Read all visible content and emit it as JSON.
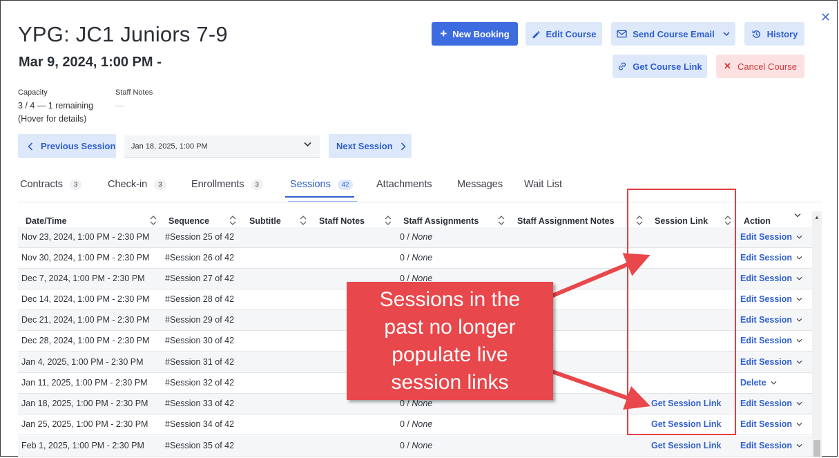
{
  "header": {
    "title": "YPG: JC1 Juniors 7-9",
    "subtitle": "Mar 9, 2024, 1:00 PM -"
  },
  "toolbar": {
    "new_booking": "New Booking",
    "edit_course": "Edit Course",
    "send_course_email": "Send Course Email",
    "history": "History",
    "get_course_link": "Get Course Link",
    "cancel_course": "Cancel Course"
  },
  "meta": {
    "capacity_label": "Capacity",
    "capacity_value": "3 / 4 — 1 remaining",
    "capacity_hint": "(Hover for details)",
    "staff_notes_label": "Staff Notes",
    "staff_notes_value": "—"
  },
  "session_nav": {
    "previous": "Previous Session",
    "selected": "Jan 18, 2025, 1:00 PM",
    "next": "Next Session"
  },
  "tabs": [
    {
      "label": "Contracts",
      "badge": "3"
    },
    {
      "label": "Check-in",
      "badge": "3"
    },
    {
      "label": "Enrollments",
      "badge": "3"
    },
    {
      "label": "Sessions",
      "badge": "42"
    },
    {
      "label": "Attachments",
      "badge": ""
    },
    {
      "label": "Messages",
      "badge": ""
    },
    {
      "label": "Wait List",
      "badge": ""
    }
  ],
  "table": {
    "columns": [
      "Date/Time",
      "Sequence",
      "Subtitle",
      "Staff Notes",
      "Staff Assignments",
      "Staff Assignment Notes",
      "Session Link",
      "Action"
    ],
    "rows": [
      {
        "date": "Nov 23, 2024, 1:00 PM - 2:30 PM",
        "seq": "#Session 25 of 42",
        "assign_count": "0 / ",
        "assign_none": "None",
        "link": "",
        "action": "Edit Session"
      },
      {
        "date": "Nov 30, 2024, 1:00 PM - 2:30 PM",
        "seq": "#Session 26 of 42",
        "assign_count": "0 / ",
        "assign_none": "None",
        "link": "",
        "action": "Edit Session"
      },
      {
        "date": "Dec 7, 2024, 1:00 PM - 2:30 PM",
        "seq": "#Session 27 of 42",
        "assign_count": "0 / ",
        "assign_none": "None",
        "link": "",
        "action": "Edit Session"
      },
      {
        "date": "Dec 14, 2024, 1:00 PM - 2:30 PM",
        "seq": "#Session 28 of 42",
        "assign_count": "",
        "assign_none": "",
        "link": "",
        "action": "Edit Session"
      },
      {
        "date": "Dec 21, 2024, 1:00 PM - 2:30 PM",
        "seq": "#Session 29 of 42",
        "assign_count": "",
        "assign_none": "",
        "link": "",
        "action": "Edit Session"
      },
      {
        "date": "Dec 28, 2024, 1:00 PM - 2:30 PM",
        "seq": "#Session 30 of 42",
        "assign_count": "",
        "assign_none": "",
        "link": "",
        "action": "Edit Session"
      },
      {
        "date": "Jan 4, 2025, 1:00 PM - 2:30 PM",
        "seq": "#Session 31 of 42",
        "assign_count": "",
        "assign_none": "",
        "link": "",
        "action": "Edit Session"
      },
      {
        "date": "Jan 11, 2025, 1:00 PM - 2:30 PM",
        "seq": "#Session 32 of 42",
        "assign_count": "",
        "assign_none": "",
        "link": "",
        "action": "Delete"
      },
      {
        "date": "Jan 18, 2025, 1:00 PM - 2:30 PM",
        "seq": "#Session 33 of 42",
        "assign_count": "0 / ",
        "assign_none": "None",
        "link": "Get Session Link",
        "action": "Edit Session"
      },
      {
        "date": "Jan 25, 2025, 1:00 PM - 2:30 PM",
        "seq": "#Session 34 of 42",
        "assign_count": "0 / ",
        "assign_none": "None",
        "link": "Get Session Link",
        "action": "Edit Session"
      },
      {
        "date": "Feb 1, 2025, 1:00 PM - 2:30 PM",
        "seq": "#Session 35 of 42",
        "assign_count": "0 / ",
        "assign_none": "None",
        "link": "Get Session Link",
        "action": "Edit Session"
      }
    ]
  },
  "annotation": {
    "callout": "Sessions in the past no longer populate live session links",
    "color": "#e8474b"
  },
  "colors": {
    "primary": "#3d6be0",
    "light_button": "#dde8fa",
    "link": "#2f5fd0",
    "danger": "#d4383a"
  }
}
